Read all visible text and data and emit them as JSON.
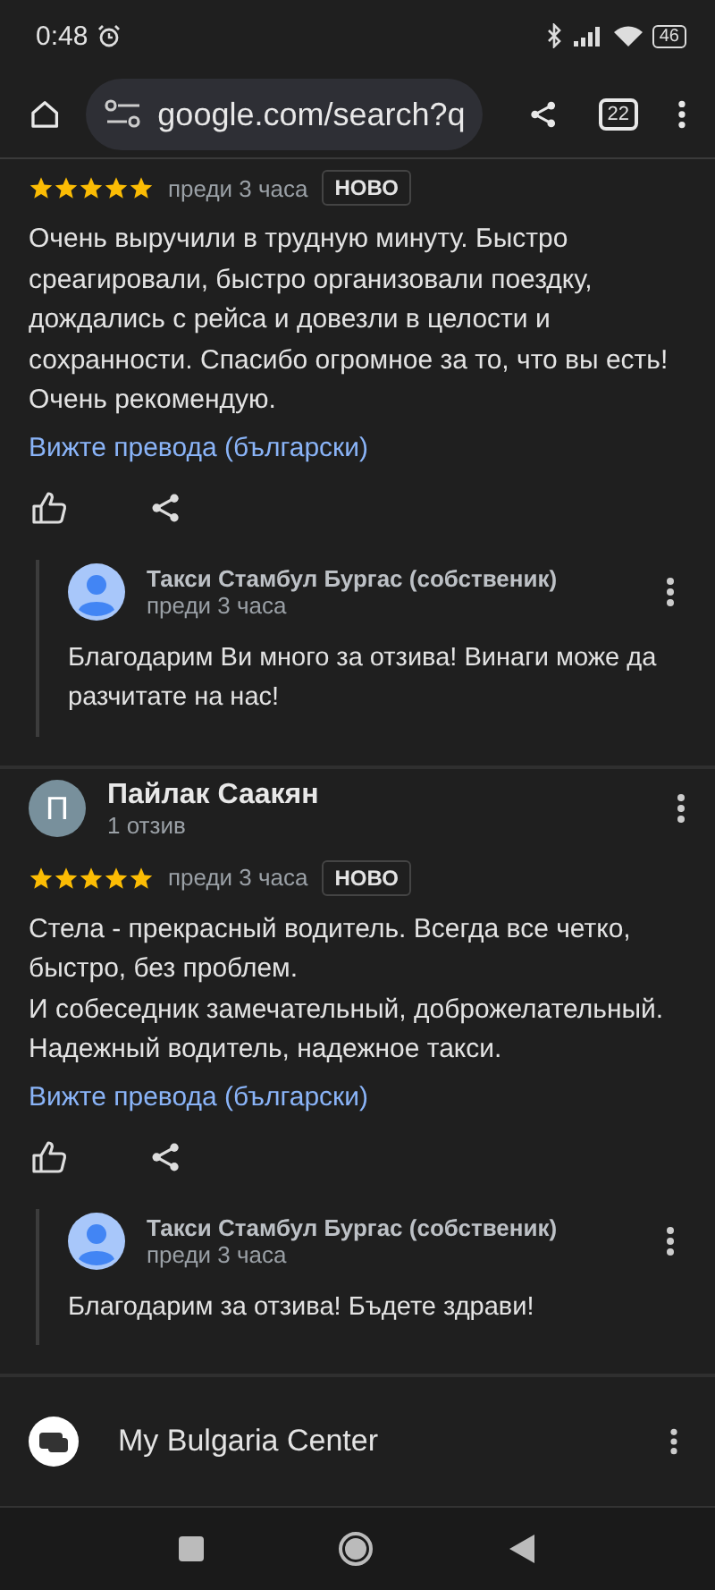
{
  "status_bar": {
    "time": "0:48",
    "battery": "46"
  },
  "toolbar": {
    "url": "google.com/search?q",
    "tab_count": "22"
  },
  "reviews": [
    {
      "stars": 5,
      "time": "преди 3 часа",
      "badge": "НОВО",
      "text": "Очень выручили в трудную минуту. Быстро среагировали, быстро организовали поездку, дождались с рейса и довезли в целости и сохранности. Спасибо огромное за то, что вы есть! Очень рекомендую.",
      "translate_link": "Вижте превода (български)",
      "reply": {
        "author": "Такси Стамбул Бургас (собственик)",
        "time": "преди 3 часа",
        "text": "Благодарим Ви много за отзива! Винаги може да разчитате на нас!"
      }
    },
    {
      "author": {
        "name": "Пайлак Саакян",
        "initial": "П",
        "review_count": "1 отзив"
      },
      "stars": 5,
      "time": "преди 3 часа",
      "badge": "НОВО",
      "text": "Стела - прекрасный водитель. Всегда все четко, быстро, без проблем.\nИ собеседник замечательный, доброжелательный. Надежный водитель, надежное такси.",
      "translate_link": "Вижте превода (български)",
      "reply": {
        "author": "Такси Стамбул Бургас (собственик)",
        "time": "преди 3 часа",
        "text": "Благодарим за отзива! Бъдете здрави!"
      }
    }
  ],
  "result": {
    "title": "My Bulgaria Center"
  }
}
